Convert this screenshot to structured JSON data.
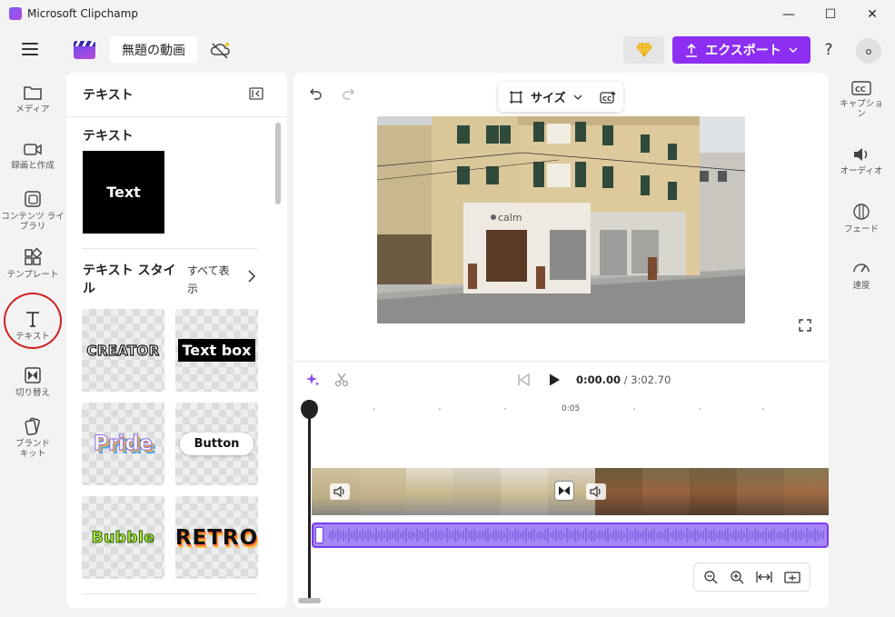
{
  "window": {
    "title": "Microsoft Clipchamp",
    "minimize": "—",
    "maximize": "☐",
    "close": "✕"
  },
  "topbar": {
    "project_name": "無題の動画",
    "export_label": "エクスポート",
    "help": "?",
    "avatar": "o"
  },
  "left_nav": [
    {
      "label": "メディア",
      "icon": "folder-icon"
    },
    {
      "label": "録画と作成",
      "icon": "camera-icon"
    },
    {
      "label": "コンテンツ ライブラリ",
      "icon": "library-icon"
    },
    {
      "label": "テンプレート",
      "icon": "templates-icon"
    },
    {
      "label": "テキスト",
      "icon": "text-icon",
      "active": true
    },
    {
      "label": "切り替え",
      "icon": "transitions-icon"
    },
    {
      "label": "ブランド キット",
      "icon": "brand-kit-icon"
    }
  ],
  "text_panel": {
    "title": "テキスト",
    "section_text": "テキスト",
    "text_thumb": "Text",
    "section_styles": "テキスト スタイル",
    "see_all": "すべて表示",
    "styles": [
      "CREATOR",
      "Text box",
      "Pride",
      "Button",
      "Bubble",
      "RETRO"
    ]
  },
  "preview": {
    "size_label": "サイズ",
    "sign_text": "calm"
  },
  "timeline": {
    "current_time": "0:00.00",
    "separator": " / ",
    "duration": "3:02.70",
    "ruler_label": "0:05"
  },
  "right_panel": [
    {
      "label": "キャプション",
      "icon": "captions-icon"
    },
    {
      "label": "オーディオ",
      "icon": "audio-icon"
    },
    {
      "label": "フェード",
      "icon": "fade-icon"
    },
    {
      "label": "速度",
      "icon": "speed-icon"
    }
  ],
  "colors": {
    "accent": "#8d2ff2",
    "audio_track": "#a486f5",
    "highlight_circle": "#d02020"
  }
}
